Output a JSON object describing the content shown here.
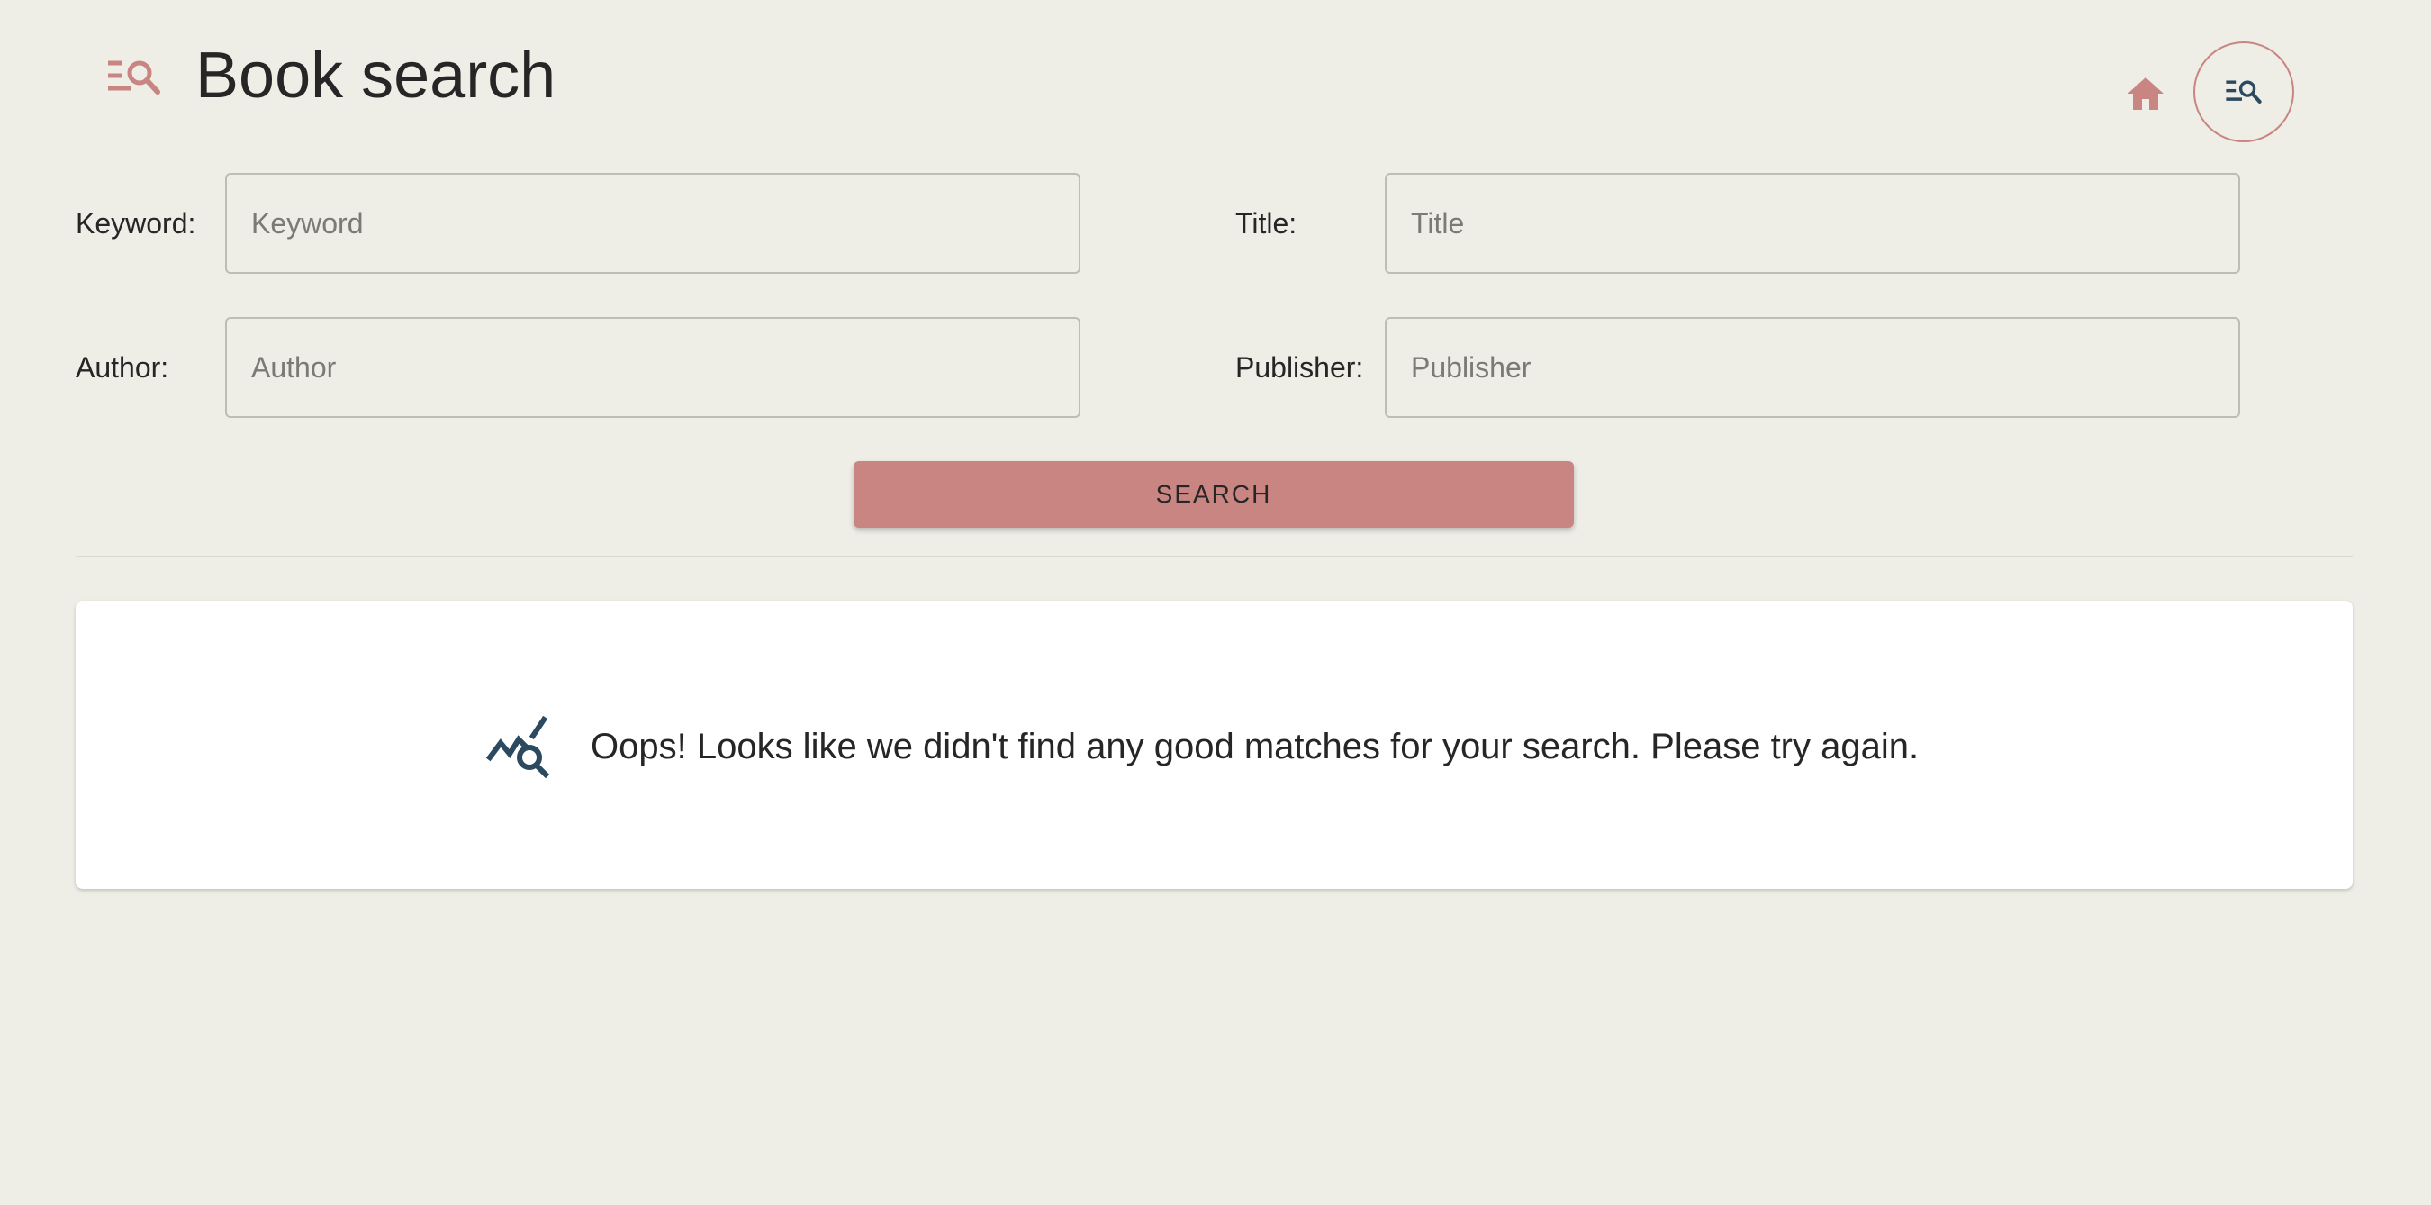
{
  "header": {
    "title": "Book search",
    "app_icon": "list-search-icon",
    "nav": {
      "home_icon": "home-icon",
      "search_icon": "list-search-icon"
    }
  },
  "form": {
    "keyword": {
      "label": "Keyword:",
      "placeholder": "Keyword",
      "value": ""
    },
    "title": {
      "label": "Title:",
      "placeholder": "Title",
      "value": ""
    },
    "author": {
      "label": "Author:",
      "placeholder": "Author",
      "value": ""
    },
    "publisher": {
      "label": "Publisher:",
      "placeholder": "Publisher",
      "value": ""
    },
    "search_label": "SEARCH"
  },
  "results": {
    "icon": "chart-search-icon",
    "message": "Oops! Looks like we didn't find any good matches for your search. Please try again."
  },
  "colors": {
    "background": "#eeede6",
    "accent": "#c98582",
    "icon_dark": "#2b4a5f",
    "text": "#262626"
  }
}
